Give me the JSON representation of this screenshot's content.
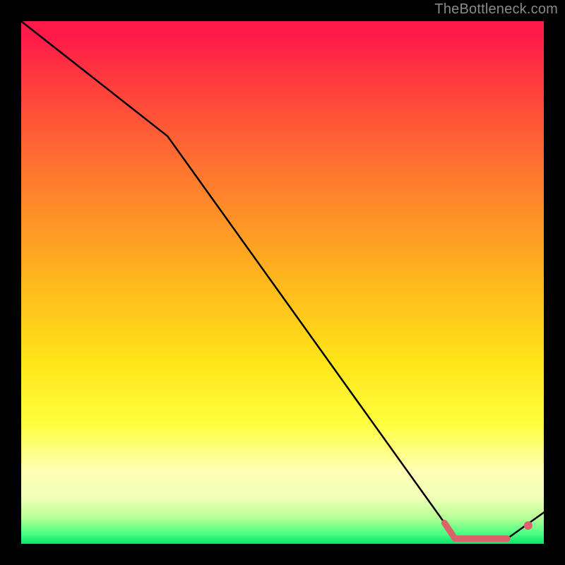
{
  "attribution": "TheBottleneck.com",
  "colors": {
    "background": "#000000",
    "line": "#000000",
    "marker_fill": "#d9626c",
    "marker_stroke": "#d9626c"
  },
  "chart_data": {
    "type": "line",
    "title": "",
    "xlabel": "",
    "ylabel": "",
    "xlim": [
      0,
      100
    ],
    "ylim": [
      0,
      100
    ],
    "series": [
      {
        "name": "curve",
        "x": [
          0,
          28,
          81,
          83,
          93,
          100
        ],
        "y": [
          100,
          78,
          4,
          1,
          1,
          6
        ],
        "style": "line"
      },
      {
        "name": "bottom-segment",
        "x": [
          81,
          83,
          84,
          85,
          86,
          87,
          88,
          89,
          90,
          91,
          92,
          93
        ],
        "y": [
          4,
          1,
          1,
          1,
          1,
          1,
          1,
          1,
          1,
          1,
          1,
          1
        ],
        "style": "line-thick-marker"
      }
    ],
    "markers": [
      {
        "x": 97,
        "y": 3.5
      }
    ],
    "gradient_stops": [
      {
        "pos": 0.0,
        "color": "#ff1a4a"
      },
      {
        "pos": 0.12,
        "color": "#ff3d3d"
      },
      {
        "pos": 0.3,
        "color": "#ff7a2e"
      },
      {
        "pos": 0.48,
        "color": "#ffb21e"
      },
      {
        "pos": 0.65,
        "color": "#ffe418"
      },
      {
        "pos": 0.77,
        "color": "#ffff3e"
      },
      {
        "pos": 0.86,
        "color": "#ffffb5"
      },
      {
        "pos": 0.95,
        "color": "#b7ff96"
      },
      {
        "pos": 1.0,
        "color": "#08e46c"
      }
    ]
  }
}
